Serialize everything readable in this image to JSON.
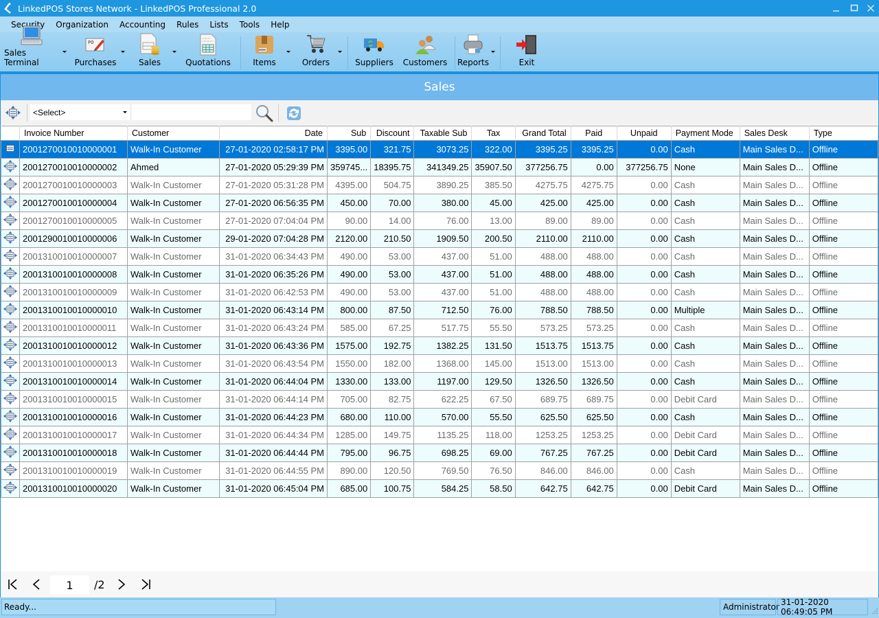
{
  "window": {
    "title": "LinkedPOS Stores Network - LinkedPOS Professional 2.0",
    "controls": {
      "minimize": "minimize",
      "maximize": "maximize",
      "close": "close"
    }
  },
  "menu": [
    "Security",
    "Organization",
    "Accounting",
    "Rules",
    "Lists",
    "Tools",
    "Help"
  ],
  "toolbar": {
    "sales_terminal": "Sales Terminal",
    "purchases": "Purchases",
    "sales": "Sales",
    "quotations": "Quotations",
    "items": "Items",
    "orders": "Orders",
    "suppliers": "Suppliers",
    "customers": "Customers",
    "reports": "Reports",
    "exit": "Exit"
  },
  "page": {
    "title": "Sales"
  },
  "search": {
    "select_value": "<Select>",
    "query": ""
  },
  "table": {
    "columns": [
      "Invoice Number",
      "Customer",
      "Date",
      "Sub",
      "Discount",
      "Taxable Sub",
      "Tax",
      "Grand Total",
      "Paid",
      "Unpaid",
      "Payment Mode",
      "Sales Desk",
      "Type"
    ],
    "rows": [
      [
        "2001270010010000001",
        "Walk-In Customer",
        "27-01-2020 02:58:17 PM",
        "3395.00",
        "321.75",
        "3073.25",
        "322.00",
        "3395.25",
        "3395.25",
        "0.00",
        "Cash",
        "Main Sales D...",
        "Offline"
      ],
      [
        "2001270010010000002",
        "Ahmed",
        "27-01-2020 05:29:39 PM",
        "359745...",
        "18395.75",
        "341349.25",
        "35907.50",
        "377256.75",
        "0.00",
        "377256.75",
        "None",
        "Main Sales D...",
        "Offline"
      ],
      [
        "2001270010010000003",
        "Walk-In Customer",
        "27-01-2020 05:31:28 PM",
        "4395.00",
        "504.75",
        "3890.25",
        "385.50",
        "4275.75",
        "4275.75",
        "0.00",
        "Cash",
        "Main Sales D...",
        "Offline"
      ],
      [
        "2001270010010000004",
        "Walk-In Customer",
        "27-01-2020 06:56:35 PM",
        "450.00",
        "70.00",
        "380.00",
        "45.00",
        "425.00",
        "425.00",
        "0.00",
        "Cash",
        "Main Sales D...",
        "Offline"
      ],
      [
        "2001270010010000005",
        "Walk-In Customer",
        "27-01-2020 07:04:04 PM",
        "90.00",
        "14.00",
        "76.00",
        "13.00",
        "89.00",
        "89.00",
        "0.00",
        "Cash",
        "Main Sales D...",
        "Offline"
      ],
      [
        "2001290010010000006",
        "Walk-In Customer",
        "29-01-2020 07:04:28 PM",
        "2120.00",
        "210.50",
        "1909.50",
        "200.50",
        "2110.00",
        "2110.00",
        "0.00",
        "Cash",
        "Main Sales D...",
        "Offline"
      ],
      [
        "2001310010010000007",
        "Walk-In Customer",
        "31-01-2020 06:34:43 PM",
        "490.00",
        "53.00",
        "437.00",
        "51.00",
        "488.00",
        "488.00",
        "0.00",
        "Cash",
        "Main Sales D...",
        "Offline"
      ],
      [
        "2001310010010000008",
        "Walk-In Customer",
        "31-01-2020 06:35:26 PM",
        "490.00",
        "53.00",
        "437.00",
        "51.00",
        "488.00",
        "488.00",
        "0.00",
        "Cash",
        "Main Sales D...",
        "Offline"
      ],
      [
        "2001310010010000009",
        "Walk-In Customer",
        "31-01-2020 06:42:53 PM",
        "490.00",
        "53.00",
        "437.00",
        "51.00",
        "488.00",
        "488.00",
        "0.00",
        "Cash",
        "Main Sales D...",
        "Offline"
      ],
      [
        "2001310010010000010",
        "Walk-In Customer",
        "31-01-2020 06:43:14 PM",
        "800.00",
        "87.50",
        "712.50",
        "76.00",
        "788.50",
        "788.50",
        "0.00",
        "Multiple",
        "Main Sales D...",
        "Offline"
      ],
      [
        "2001310010010000011",
        "Walk-In Customer",
        "31-01-2020 06:43:24 PM",
        "585.00",
        "67.25",
        "517.75",
        "55.50",
        "573.25",
        "573.25",
        "0.00",
        "Cash",
        "Main Sales D...",
        "Offline"
      ],
      [
        "2001310010010000012",
        "Walk-In Customer",
        "31-01-2020 06:43:36 PM",
        "1575.00",
        "192.75",
        "1382.25",
        "131.50",
        "1513.75",
        "1513.75",
        "0.00",
        "Cash",
        "Main Sales D...",
        "Offline"
      ],
      [
        "2001310010010000013",
        "Walk-In Customer",
        "31-01-2020 06:43:54 PM",
        "1550.00",
        "182.00",
        "1368.00",
        "145.00",
        "1513.00",
        "1513.00",
        "0.00",
        "Cash",
        "Main Sales D...",
        "Offline"
      ],
      [
        "2001310010010000014",
        "Walk-In Customer",
        "31-01-2020 06:44:04 PM",
        "1330.00",
        "133.00",
        "1197.00",
        "129.50",
        "1326.50",
        "1326.50",
        "0.00",
        "Cash",
        "Main Sales D...",
        "Offline"
      ],
      [
        "2001310010010000015",
        "Walk-In Customer",
        "31-01-2020 06:44:14 PM",
        "705.00",
        "82.75",
        "622.25",
        "67.50",
        "689.75",
        "689.75",
        "0.00",
        "Debit Card",
        "Main Sales D...",
        "Offline"
      ],
      [
        "2001310010010000016",
        "Walk-In Customer",
        "31-01-2020 06:44:23 PM",
        "680.00",
        "110.00",
        "570.00",
        "55.50",
        "625.50",
        "625.50",
        "0.00",
        "Cash",
        "Main Sales D...",
        "Offline"
      ],
      [
        "2001310010010000017",
        "Walk-In Customer",
        "31-01-2020 06:44:34 PM",
        "1285.00",
        "149.75",
        "1135.25",
        "118.00",
        "1253.25",
        "1253.25",
        "0.00",
        "Debit Card",
        "Main Sales D...",
        "Offline"
      ],
      [
        "2001310010010000018",
        "Walk-In Customer",
        "31-01-2020 06:44:44 PM",
        "795.00",
        "96.75",
        "698.25",
        "69.00",
        "767.25",
        "767.25",
        "0.00",
        "Debit Card",
        "Main Sales D...",
        "Offline"
      ],
      [
        "2001310010010000019",
        "Walk-In Customer",
        "31-01-2020 06:44:55 PM",
        "890.00",
        "120.50",
        "769.50",
        "76.50",
        "846.00",
        "846.00",
        "0.00",
        "Cash",
        "Main Sales D...",
        "Offline"
      ],
      [
        "2001310010010000020",
        "Walk-In Customer",
        "31-01-2020 06:45:04 PM",
        "685.00",
        "100.75",
        "584.25",
        "58.50",
        "642.75",
        "642.75",
        "0.00",
        "Debit Card",
        "Main Sales D...",
        "Offline"
      ]
    ],
    "selected_row": 0
  },
  "pager": {
    "current_page": "1",
    "total_label": "/2",
    "first": "first-page",
    "prev": "previous-page",
    "next": "next-page",
    "last": "last-page"
  },
  "status": {
    "message": "Ready...",
    "user": "Administrator",
    "datetime": "31-01-2020 06:49:05 PM"
  },
  "colors": {
    "titlebar": "#1e96e0",
    "menubar": "#afdbf5",
    "header_band": "#70b8ee",
    "selected_row": "#0078d7",
    "alt_row": "#edfdfd"
  }
}
